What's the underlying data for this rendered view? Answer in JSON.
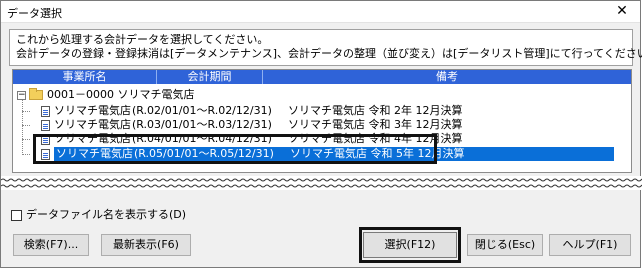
{
  "window": {
    "title": "データ選択",
    "close_glyph": "✕"
  },
  "instructions": {
    "line1": "これから処理する会計データを選択してください。",
    "line2": "会計データの登録・登録抹消は[データメンテナンス]、会計データの整理（並び変え）は[データリスト管理]にて行ってください。"
  },
  "list": {
    "columns": [
      "事業所名",
      "会計期間",
      "備考"
    ],
    "root": {
      "label": "0001－0000 ソリマチ電気店",
      "expander": "−"
    },
    "rows": [
      {
        "name": "ソリマチ電気店",
        "period": "(R.02/01/01～R.02/12/31)",
        "note": "ソリマチ電気店 令和 2年 12月決算",
        "selected": false
      },
      {
        "name": "ソリマチ電気店",
        "period": "(R.03/01/01～R.03/12/31)",
        "note": "ソリマチ電気店 令和 3年 12月決算",
        "selected": false
      },
      {
        "name": "ソリマチ電気店",
        "period": "(R.04/01/01～R.04/12/31)",
        "note": "ソリマチ電気店 令和 4年 12月決算",
        "selected": false
      },
      {
        "name": "ソリマチ電気店",
        "period": "(R.05/01/01～R.05/12/31)",
        "note": "ソリマチ電気店 令和 5年 12月決算",
        "selected": true
      }
    ]
  },
  "checkbox": {
    "label": "データファイル名を表示する(D)",
    "checked": false
  },
  "buttons": {
    "search": "検索(F7)...",
    "refresh": "最新表示(F6)",
    "select": "選択(F12)",
    "close": "閉じる(Esc)",
    "help": "ヘルプ(F1)"
  },
  "colors": {
    "header_bg": "#2f63d8",
    "selection_bg": "#0a6fd8"
  }
}
